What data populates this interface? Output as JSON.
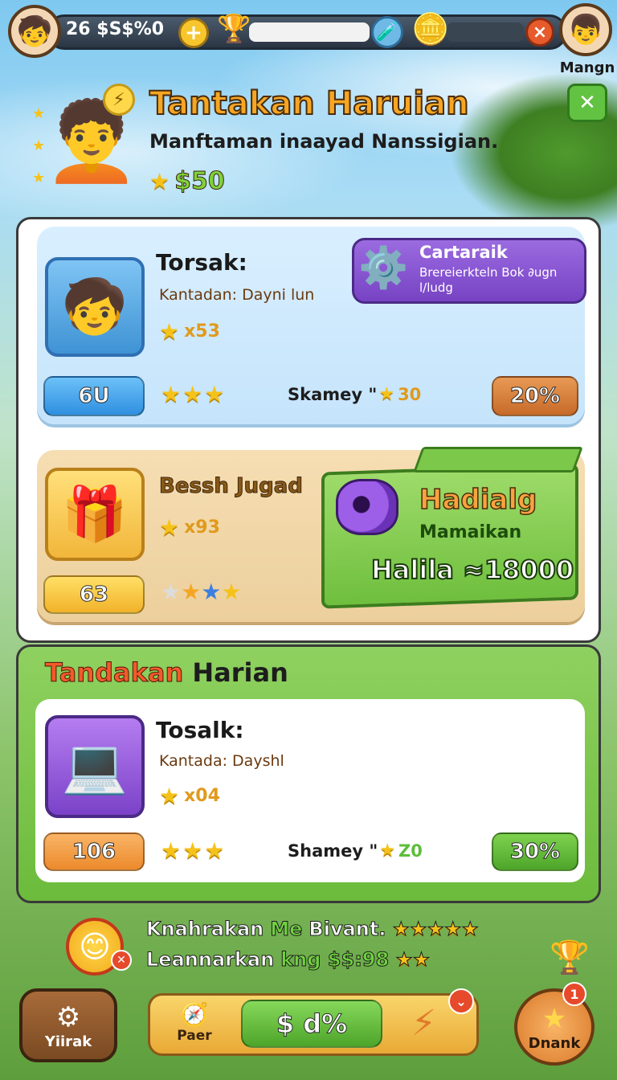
{
  "topbar": {
    "currency_text": "26 $S$%0",
    "plus_label": "+",
    "close_label": "×",
    "player_name": "Mangn"
  },
  "header": {
    "title": "Tantakan Haruian",
    "subtitle": "Manftaman inaayad Nanssigian.",
    "reward": "$50",
    "close_label": "✕"
  },
  "card1": {
    "title": "Torsak:",
    "desc": "Kantadan: Dayni lun",
    "star_count": "x53",
    "button_label": "6U",
    "share_label": "Skamey \"",
    "share_value": "30",
    "percent_label": "20%",
    "promo_title": "Cartaraik",
    "promo_desc": "Brereierkteln Bok ∂ugn l/ludg"
  },
  "card2": {
    "title": "Bessh Jugad",
    "star_count": "x93",
    "button_label": "63",
    "banner_title": "Hadialg",
    "banner_sub": "Mamaikan",
    "banner_value": "Halila ≈18000"
  },
  "section2": {
    "header": "Tandakan",
    "header_rest": "Harian",
    "title": "Tosalk:",
    "desc": "Kantada: Dayshl",
    "star_count": "x04",
    "button_label": "106",
    "share_label": "Shamey \"",
    "share_value": "Z0",
    "percent_label": "30%"
  },
  "footer_notice": {
    "line1_a": "Knahrakan",
    "line1_b": "Me",
    "line1_c": "Bivant.",
    "line2_a": "Leannarkan",
    "line2_b": "kng $$:98"
  },
  "bottom": {
    "left_button": "Yiirak",
    "center_small": "Paer",
    "center_main": "$ d%",
    "right_button": "Dnank",
    "right_badge": "1"
  },
  "colors": {
    "title_orange": "#f6a623",
    "green_btn": "#5cbf3a",
    "blue_btn": "#3fa0ea",
    "orange_btn": "#d67a3b",
    "yellow_btn": "#f7c52a"
  }
}
